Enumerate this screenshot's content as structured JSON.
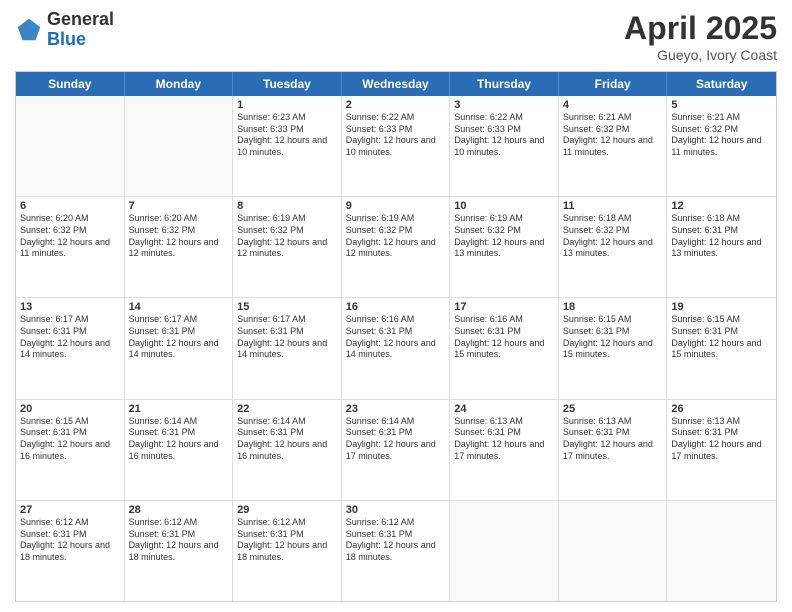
{
  "header": {
    "logo_general": "General",
    "logo_blue": "Blue",
    "title": "April 2025",
    "subtitle": "Gueyo, Ivory Coast"
  },
  "weekdays": [
    "Sunday",
    "Monday",
    "Tuesday",
    "Wednesday",
    "Thursday",
    "Friday",
    "Saturday"
  ],
  "rows": [
    [
      {
        "day": "",
        "empty": true
      },
      {
        "day": "",
        "empty": true
      },
      {
        "day": "1",
        "sunrise": "6:23 AM",
        "sunset": "6:33 PM",
        "daylight": "12 hours and 10 minutes."
      },
      {
        "day": "2",
        "sunrise": "6:22 AM",
        "sunset": "6:33 PM",
        "daylight": "12 hours and 10 minutes."
      },
      {
        "day": "3",
        "sunrise": "6:22 AM",
        "sunset": "6:33 PM",
        "daylight": "12 hours and 10 minutes."
      },
      {
        "day": "4",
        "sunrise": "6:21 AM",
        "sunset": "6:32 PM",
        "daylight": "12 hours and 11 minutes."
      },
      {
        "day": "5",
        "sunrise": "6:21 AM",
        "sunset": "6:32 PM",
        "daylight": "12 hours and 11 minutes."
      }
    ],
    [
      {
        "day": "6",
        "sunrise": "6:20 AM",
        "sunset": "6:32 PM",
        "daylight": "12 hours and 11 minutes."
      },
      {
        "day": "7",
        "sunrise": "6:20 AM",
        "sunset": "6:32 PM",
        "daylight": "12 hours and 12 minutes."
      },
      {
        "day": "8",
        "sunrise": "6:19 AM",
        "sunset": "6:32 PM",
        "daylight": "12 hours and 12 minutes."
      },
      {
        "day": "9",
        "sunrise": "6:19 AM",
        "sunset": "6:32 PM",
        "daylight": "12 hours and 12 minutes."
      },
      {
        "day": "10",
        "sunrise": "6:19 AM",
        "sunset": "6:32 PM",
        "daylight": "12 hours and 13 minutes."
      },
      {
        "day": "11",
        "sunrise": "6:18 AM",
        "sunset": "6:32 PM",
        "daylight": "12 hours and 13 minutes."
      },
      {
        "day": "12",
        "sunrise": "6:18 AM",
        "sunset": "6:31 PM",
        "daylight": "12 hours and 13 minutes."
      }
    ],
    [
      {
        "day": "13",
        "sunrise": "6:17 AM",
        "sunset": "6:31 PM",
        "daylight": "12 hours and 14 minutes."
      },
      {
        "day": "14",
        "sunrise": "6:17 AM",
        "sunset": "6:31 PM",
        "daylight": "12 hours and 14 minutes."
      },
      {
        "day": "15",
        "sunrise": "6:17 AM",
        "sunset": "6:31 PM",
        "daylight": "12 hours and 14 minutes."
      },
      {
        "day": "16",
        "sunrise": "6:16 AM",
        "sunset": "6:31 PM",
        "daylight": "12 hours and 14 minutes."
      },
      {
        "day": "17",
        "sunrise": "6:16 AM",
        "sunset": "6:31 PM",
        "daylight": "12 hours and 15 minutes."
      },
      {
        "day": "18",
        "sunrise": "6:15 AM",
        "sunset": "6:31 PM",
        "daylight": "12 hours and 15 minutes."
      },
      {
        "day": "19",
        "sunrise": "6:15 AM",
        "sunset": "6:31 PM",
        "daylight": "12 hours and 15 minutes."
      }
    ],
    [
      {
        "day": "20",
        "sunrise": "6:15 AM",
        "sunset": "6:31 PM",
        "daylight": "12 hours and 16 minutes."
      },
      {
        "day": "21",
        "sunrise": "6:14 AM",
        "sunset": "6:31 PM",
        "daylight": "12 hours and 16 minutes."
      },
      {
        "day": "22",
        "sunrise": "6:14 AM",
        "sunset": "6:31 PM",
        "daylight": "12 hours and 16 minutes."
      },
      {
        "day": "23",
        "sunrise": "6:14 AM",
        "sunset": "6:31 PM",
        "daylight": "12 hours and 17 minutes."
      },
      {
        "day": "24",
        "sunrise": "6:13 AM",
        "sunset": "6:31 PM",
        "daylight": "12 hours and 17 minutes."
      },
      {
        "day": "25",
        "sunrise": "6:13 AM",
        "sunset": "6:31 PM",
        "daylight": "12 hours and 17 minutes."
      },
      {
        "day": "26",
        "sunrise": "6:13 AM",
        "sunset": "6:31 PM",
        "daylight": "12 hours and 17 minutes."
      }
    ],
    [
      {
        "day": "27",
        "sunrise": "6:12 AM",
        "sunset": "6:31 PM",
        "daylight": "12 hours and 18 minutes."
      },
      {
        "day": "28",
        "sunrise": "6:12 AM",
        "sunset": "6:31 PM",
        "daylight": "12 hours and 18 minutes."
      },
      {
        "day": "29",
        "sunrise": "6:12 AM",
        "sunset": "6:31 PM",
        "daylight": "12 hours and 18 minutes."
      },
      {
        "day": "30",
        "sunrise": "6:12 AM",
        "sunset": "6:31 PM",
        "daylight": "12 hours and 18 minutes."
      },
      {
        "day": "",
        "empty": true
      },
      {
        "day": "",
        "empty": true
      },
      {
        "day": "",
        "empty": true
      }
    ]
  ]
}
